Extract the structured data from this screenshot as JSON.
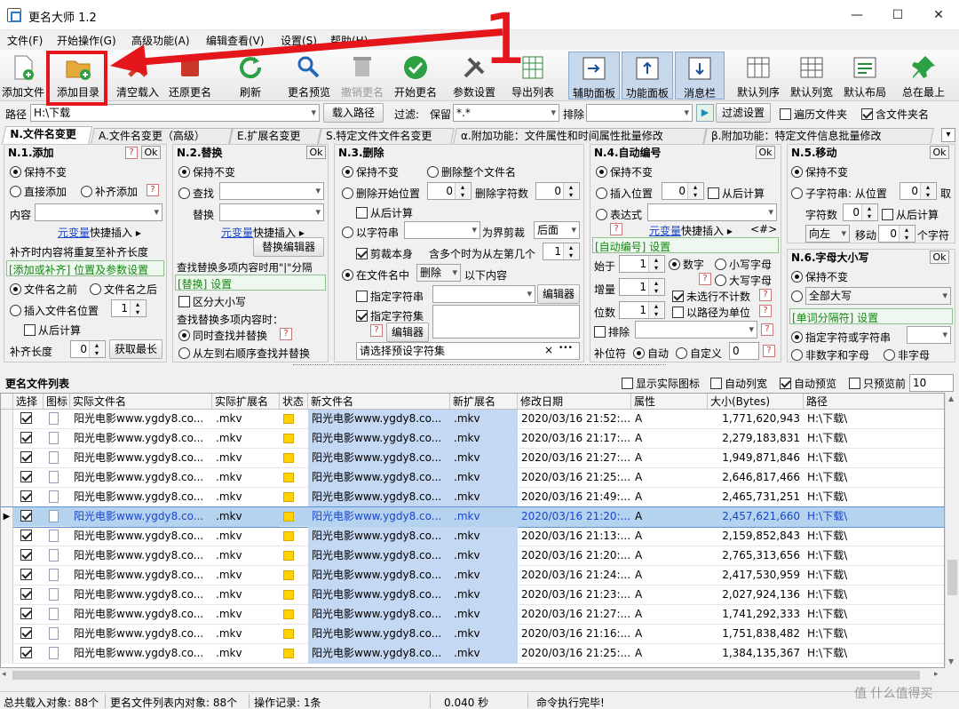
{
  "window": {
    "title": "更名大师 1.2",
    "min_glyph": "—",
    "max_glyph": "☐",
    "close_glyph": "✕"
  },
  "menu": [
    "文件(F)",
    "开始操作(G)",
    "高级功能(A)",
    "编辑查看(V)",
    "设置(S)",
    "帮助(H)"
  ],
  "toolbar": [
    {
      "label": "添加文件",
      "icon": "add-file-icon"
    },
    {
      "label": "添加目录",
      "icon": "add-folder-icon"
    },
    {
      "label": "清空载入",
      "icon": "clear-icon"
    },
    {
      "label": "还原更名",
      "icon": "undo-icon"
    },
    {
      "label": "刷新",
      "icon": "refresh-icon"
    },
    {
      "label": "更名预览",
      "icon": "preview-icon"
    },
    {
      "label": "撤销更名",
      "icon": "revert-icon"
    },
    {
      "label": "开始更名",
      "icon": "check-icon"
    },
    {
      "label": "参数设置",
      "icon": "tools-icon"
    },
    {
      "label": "导出列表",
      "icon": "export-icon"
    },
    {
      "label": "辅助面板",
      "icon": "panel-icon"
    },
    {
      "label": "功能面板",
      "icon": "panel-up-icon"
    },
    {
      "label": "消息栏",
      "icon": "message-icon"
    },
    {
      "label": "默认列序",
      "icon": "column-order-icon"
    },
    {
      "label": "默认列宽",
      "icon": "column-width-icon"
    },
    {
      "label": "默认布局",
      "icon": "layout-icon"
    },
    {
      "label": "总在最上",
      "icon": "pin-icon"
    }
  ],
  "pathbar": {
    "path_label": "路径",
    "path_value": "H:\\下载",
    "load_button": "载入路径",
    "filter_label": "过滤:",
    "keep_label": "保留",
    "keep_value": "*.*",
    "exclude_label": "排除",
    "play_glyph": "▶",
    "filter_settings": "过滤设置",
    "traverse_label": "遍历文件夹",
    "include_folder_label": "含文件夹名"
  },
  "tabs": [
    "N.文件名变更",
    "A.文件名变更（高级）",
    "E.扩展名变更",
    "S.特定文件文件名变更",
    "α.附加功能：文件属性和时间属性批量修改",
    "β.附加功能：特定文件信息批量修改"
  ],
  "p1": {
    "title": "N.1.添加",
    "q": "?",
    "ok": "Ok",
    "keep": "保持不变",
    "direct": "直接添加",
    "pad": "补齐添加",
    "content_label": "内容",
    "var_link": "元变量",
    "quick_insert": "快捷插入",
    "pad_note": "补齐时内容将重复至补齐长度",
    "settings_hint": "[添加或补齐] 位置及参数设置",
    "before": "文件名之前",
    "after": "文件名之后",
    "insert_pos": "插入文件名位置",
    "insert_pos_val": "1",
    "from_end": "从后计算",
    "pad_len_label": "补齐长度",
    "pad_len_val": "0",
    "get_max": "获取最长"
  },
  "p2": {
    "title": "N.2.替换",
    "ok": "Ok",
    "keep": "保持不变",
    "find": "查找",
    "replace": "替换",
    "var_link": "元变量",
    "quick_insert": "快捷插入",
    "editor": "替换编辑器",
    "multi_note": "查找替换多项内容时用\"|\"分隔",
    "replace_hint": "[替换] 设置",
    "case": "区分大小写",
    "multi_q": "查找替换多项内容时：",
    "simul": "同时查找并替换",
    "q": "?",
    "ltr": "从左到右顺序查找并替换"
  },
  "p3": {
    "title": "N.3.删除",
    "keep": "保持不变",
    "delete_all": "删除整个文件名",
    "del_from": "删除开始位置",
    "del_from_val": "0",
    "del_count": "删除字符数",
    "del_count_val": "0",
    "from_end": "从后计算",
    "by_str": "以字符串",
    "as_bound": "为界剪裁",
    "after_opt": "后面",
    "cut_self": "剪裁本身",
    "multi": "含多个时为从左第几个",
    "multi_val": "1",
    "in_name": "在文件名中",
    "del_opt": "删除",
    "below": "以下内容",
    "spec_str": "指定字符串",
    "editor": "编辑器",
    "spec_set": "指定字符集",
    "q": "?",
    "editor2": "编辑器",
    "preset_placeholder": "请选择预设字符集",
    "x_glyph": "×",
    "more_glyph": "•••"
  },
  "p4": {
    "title": "N.4.自动编号",
    "ok": "Ok",
    "keep": "保持不变",
    "insert_pos": "插入位置",
    "insert_pos_val": "0",
    "from_end": "从后计算",
    "expr": "表达式",
    "q": "?",
    "var_link": "元变量",
    "quick_insert": "快捷插入",
    "tag": "<#>",
    "auto_hint": "[自动编号] 设置",
    "start": "始于",
    "start_val": "1",
    "digits": "数字",
    "lower": "小写字母",
    "upper": "大写字母",
    "step": "增量",
    "step_val": "1",
    "not_selected": "未选行不计数",
    "width": "位数",
    "width_val": "1",
    "by_path": "以路径为单位",
    "exclude": "排除",
    "pad_char": "补位符",
    "auto": "自动",
    "custom": "自定义",
    "custom_val": "0"
  },
  "p5": {
    "title": "N.5.移动",
    "ok": "Ok",
    "keep": "保持不变",
    "substr": "子字符串: 从位置",
    "substr_val": "0",
    "take": "取",
    "char_count": "字符数",
    "char_count_val": "0",
    "from_end": "从后计算",
    "dir": "向左",
    "move": "移动",
    "move_val": "0",
    "per_char": "个字符"
  },
  "p6": {
    "title": "N.6.字母大小写",
    "ok": "Ok",
    "keep": "保持不变",
    "all_upper": "全部大写",
    "q": "?",
    "sep_hint": "[单词分隔符] 设置",
    "spec": "指定字符或字符串",
    "non_digit": "非数字和字母",
    "non_char": "非字母"
  },
  "list": {
    "title": "更名文件列表",
    "show_icon": "显示实际图标",
    "auto_col": "自动列宽",
    "auto_preview": "自动预览",
    "preview_first": "只预览前",
    "preview_first_val": "10",
    "columns": [
      "选择",
      "图标",
      "实际文件名",
      "实际扩展名",
      "状态",
      "新文件名",
      "新扩展名",
      "修改日期",
      "属性",
      "大小(Bytes)",
      "路径"
    ],
    "rows": [
      {
        "name": "阳光电影www.ygdy8.co...",
        "ext": ".mkv",
        "new": "阳光电影www.ygdy8.co...",
        "newext": ".mkv",
        "date": "2020/03/16 21:52:...",
        "attr": "A",
        "size": "1,771,620,943",
        "path": "H:\\下载\\"
      },
      {
        "name": "阳光电影www.ygdy8.co...",
        "ext": ".mkv",
        "new": "阳光电影www.ygdy8.co...",
        "newext": ".mkv",
        "date": "2020/03/16 21:17:...",
        "attr": "A",
        "size": "2,279,183,831",
        "path": "H:\\下载\\"
      },
      {
        "name": "阳光电影www.ygdy8.co...",
        "ext": ".mkv",
        "new": "阳光电影www.ygdy8.co...",
        "newext": ".mkv",
        "date": "2020/03/16 21:27:...",
        "attr": "A",
        "size": "1,949,871,846",
        "path": "H:\\下载\\"
      },
      {
        "name": "阳光电影www.ygdy8.co...",
        "ext": ".mkv",
        "new": "阳光电影www.ygdy8.co...",
        "newext": ".mkv",
        "date": "2020/03/16 21:25:...",
        "attr": "A",
        "size": "2,646,817,466",
        "path": "H:\\下载\\"
      },
      {
        "name": "阳光电影www.ygdy8.co...",
        "ext": ".mkv",
        "new": "阳光电影www.ygdy8.co...",
        "newext": ".mkv",
        "date": "2020/03/16 21:49:...",
        "attr": "A",
        "size": "2,465,731,251",
        "path": "H:\\下载\\"
      },
      {
        "name": "阳光电影www.ygdy8.co...",
        "ext": ".mkv",
        "new": "阳光电影www.ygdy8.co...",
        "newext": ".mkv",
        "date": "2020/03/16 21:20:...",
        "attr": "A",
        "size": "2,457,621,660",
        "path": "H:\\下载\\"
      },
      {
        "name": "阳光电影www.ygdy8.co...",
        "ext": ".mkv",
        "new": "阳光电影www.ygdy8.co...",
        "newext": ".mkv",
        "date": "2020/03/16 21:13:...",
        "attr": "A",
        "size": "2,159,852,843",
        "path": "H:\\下载\\"
      },
      {
        "name": "阳光电影www.ygdy8.co...",
        "ext": ".mkv",
        "new": "阳光电影www.ygdy8.co...",
        "newext": ".mkv",
        "date": "2020/03/16 21:20:...",
        "attr": "A",
        "size": "2,765,313,656",
        "path": "H:\\下载\\"
      },
      {
        "name": "阳光电影www.ygdy8.co...",
        "ext": ".mkv",
        "new": "阳光电影www.ygdy8.co...",
        "newext": ".mkv",
        "date": "2020/03/16 21:24:...",
        "attr": "A",
        "size": "2,417,530,959",
        "path": "H:\\下载\\"
      },
      {
        "name": "阳光电影www.ygdy8.co...",
        "ext": ".mkv",
        "new": "阳光电影www.ygdy8.co...",
        "newext": ".mkv",
        "date": "2020/03/16 21:23:...",
        "attr": "A",
        "size": "2,027,924,136",
        "path": "H:\\下载\\"
      },
      {
        "name": "阳光电影www.ygdy8.co...",
        "ext": ".mkv",
        "new": "阳光电影www.ygdy8.co...",
        "newext": ".mkv",
        "date": "2020/03/16 21:27:...",
        "attr": "A",
        "size": "1,741,292,333",
        "path": "H:\\下载\\"
      },
      {
        "name": "阳光电影www.ygdy8.co...",
        "ext": ".mkv",
        "new": "阳光电影www.ygdy8.co...",
        "newext": ".mkv",
        "date": "2020/03/16 21:16:...",
        "attr": "A",
        "size": "1,751,838,482",
        "path": "H:\\下载\\"
      },
      {
        "name": "阳光电影www.ygdy8.co...",
        "ext": ".mkv",
        "new": "阳光电影www.ygdy8.co...",
        "newext": ".mkv",
        "date": "2020/03/16 21:25:...",
        "attr": "A",
        "size": "1,384,135,367",
        "path": "H:\\下载\\"
      }
    ],
    "selected_row": 5
  },
  "status": {
    "loaded": "总共载入对象: 88个",
    "in_list": "更名文件列表内对象: 88个",
    "ops": "操作记录: 1条",
    "time": "0.040 秒",
    "msg": "命令执行完毕!"
  },
  "annotation": {
    "number": "1"
  },
  "watermark": "值 什么值得买",
  "colors": {
    "annotation_red": "#e4161b",
    "selection_blue": "#b5d2ef",
    "new_col_blue": "#c4d8f4",
    "status_yellow": "#ffd200"
  }
}
